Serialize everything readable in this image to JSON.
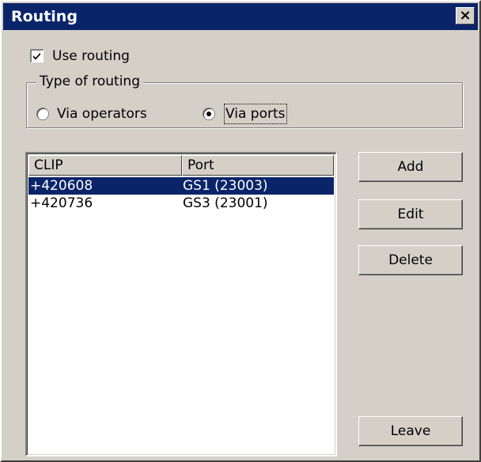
{
  "window": {
    "title": "Routing",
    "close_symbol": "×"
  },
  "use_routing": {
    "label": "Use routing",
    "checked": true
  },
  "routing_type": {
    "legend": "Type of routing",
    "options": [
      {
        "label": "Via operators",
        "selected": false
      },
      {
        "label": "Via ports",
        "selected": true
      }
    ]
  },
  "table": {
    "columns": [
      "CLIP",
      "Port"
    ],
    "rows": [
      {
        "clip": "+420608",
        "port": "GS1 (23003)",
        "selected": true
      },
      {
        "clip": "+420736",
        "port": "GS3 (23001)",
        "selected": false
      }
    ]
  },
  "buttons": {
    "add": "Add",
    "edit": "Edit",
    "delete": "Delete",
    "leave": "Leave"
  },
  "colors": {
    "title_bar": "#0a246a",
    "face": "#d4d0c8",
    "selection": "#0a246a"
  },
  "icons": {
    "close": "close-icon",
    "check": "checkmark-icon"
  }
}
